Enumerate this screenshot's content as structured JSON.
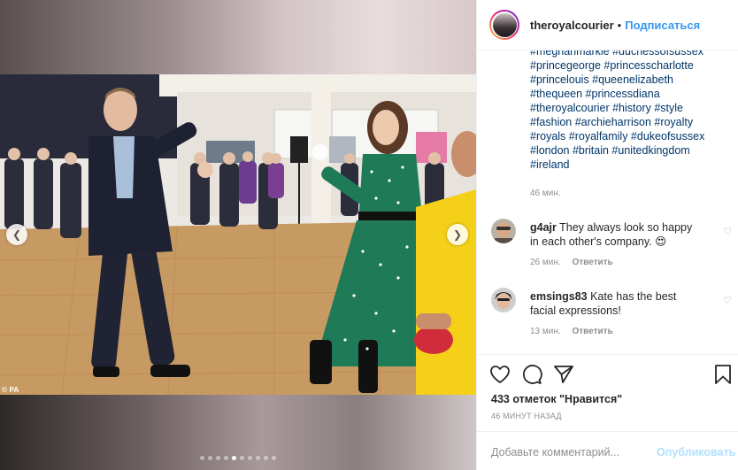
{
  "media": {
    "credit": "© PA",
    "slide_count": 10,
    "active_slide": 5
  },
  "header": {
    "username": "theroyalcourier",
    "separator": "•",
    "follow_label": "Подписаться"
  },
  "caption": {
    "tags": [
      "#meghanmarkle #duchessofsussex",
      "#princegeorge #princesscharlotte",
      "#princelouis #queenelizabeth",
      "#thequeen #princessdiana",
      "#theroyalcourier #history #style",
      "#fashion #archieharrison #royalty",
      "#royals #royalfamily #dukeofsussex",
      "#london #britain #unitedkingdom",
      "#ireland"
    ],
    "time": "46 мин."
  },
  "comments": [
    {
      "username": "g4ajr",
      "text_line1": " They always look so happy",
      "text_line2": "in each other's company. 😍",
      "time": "26 мин.",
      "reply_label": "Ответить"
    },
    {
      "username": "emsings83",
      "text_line1": " Kate has the best",
      "text_line2": "facial expressions!",
      "time": "13 мин.",
      "reply_label": "Ответить"
    }
  ],
  "actions": {
    "likes": "433 отметок \"Нравится\"",
    "posted": "46 МИНУТ НАЗАД"
  },
  "add_comment": {
    "placeholder": "Добавьте комментарий...",
    "publish_label": "Опубликовать"
  },
  "colors": {
    "link": "#003569",
    "follow": "#3897f0",
    "publish_disabled": "#b2dffc",
    "muted": "#8e8e8e"
  }
}
